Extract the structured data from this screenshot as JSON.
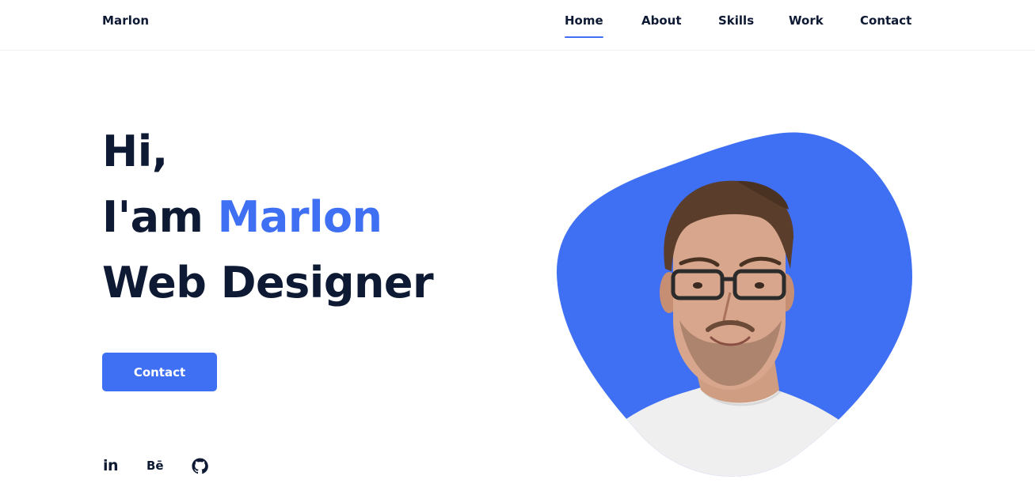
{
  "header": {
    "logo": "Marlon",
    "nav": [
      {
        "label": "Home",
        "active": true
      },
      {
        "label": "About",
        "active": false
      },
      {
        "label": "Skills",
        "active": false
      },
      {
        "label": "Work",
        "active": false
      },
      {
        "label": "Contact",
        "active": false
      }
    ]
  },
  "hero": {
    "greeting": "Hi,",
    "intro_prefix": "I'am ",
    "name": "Marlon",
    "role": "Web Designer",
    "cta_label": "Contact"
  },
  "social": {
    "linkedin_label": "in",
    "behance_label": "Bē",
    "github_icon": "github-icon"
  },
  "colors": {
    "accent": "#3f6ff3",
    "text": "#0e1a33",
    "background": "#ffffff"
  }
}
